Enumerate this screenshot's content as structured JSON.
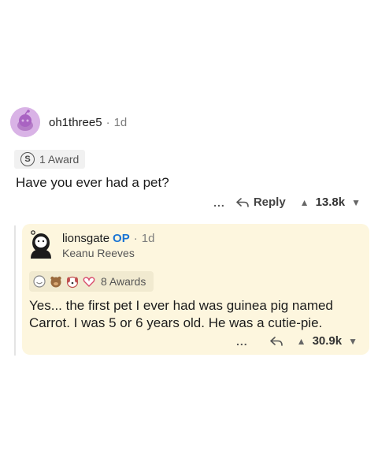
{
  "top_comment": {
    "username": "oh1three5",
    "time": "1d",
    "award_count": "1 Award",
    "body": "Have you ever had a pet?",
    "reply_label": "Reply",
    "score": "13.8k",
    "more": "..."
  },
  "reply_comment": {
    "username": "lionsgate",
    "op_tag": "OP",
    "time": "1d",
    "flair": "Keanu Reeves",
    "award_count": "8 Awards",
    "body": "Yes... the first pet I ever had was guinea pig named Carrot. I was 5 or 6 years old. He was a cutie-pie.",
    "score": "30.9k",
    "more": "..."
  },
  "colors": {
    "op": "#1a74d4",
    "card_bg": "#fdf6de",
    "avatar_bg": "#d9b3e6"
  },
  "icons": [
    "snoo-avatar",
    "silver-award-icon",
    "reply-arrow-icon",
    "upvote-icon",
    "downvote-icon",
    "keanu-avatar",
    "award-icons"
  ]
}
